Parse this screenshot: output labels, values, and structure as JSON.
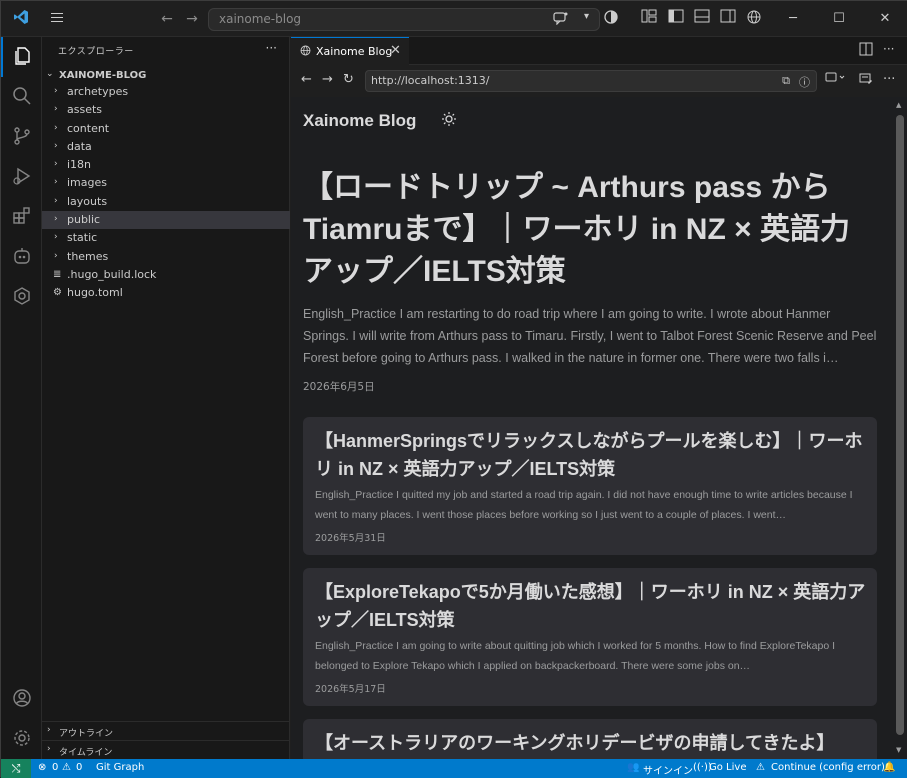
{
  "titlebar": {
    "search_text": "xainome-blog"
  },
  "sidebar": {
    "title": "エクスプローラー",
    "root": "XAINOME-BLOG",
    "items": [
      {
        "label": "archetypes",
        "type": "folder"
      },
      {
        "label": "assets",
        "type": "folder"
      },
      {
        "label": "content",
        "type": "folder"
      },
      {
        "label": "data",
        "type": "folder"
      },
      {
        "label": "i18n",
        "type": "folder"
      },
      {
        "label": "images",
        "type": "folder"
      },
      {
        "label": "layouts",
        "type": "folder"
      },
      {
        "label": "public",
        "type": "folder",
        "selected": true
      },
      {
        "label": "static",
        "type": "folder"
      },
      {
        "label": "themes",
        "type": "folder"
      },
      {
        "label": ".hugo_build.lock",
        "type": "file"
      },
      {
        "label": "hugo.toml",
        "type": "settings-file"
      }
    ],
    "outline_label": "アウトライン",
    "timeline_label": "タイムライン"
  },
  "editor": {
    "tab_title": "Xainome Blog",
    "url": "http://localhost:1313/"
  },
  "page": {
    "site_title": "Xainome Blog",
    "hero": {
      "title": "【ロードトリップ ~ Arthurs pass から Tiamruまで】｜ワーホリ in NZ × 英語力アップ／IELTS対策",
      "summary": "English_Practice I am restarting to do road trip where I am going to write. I wrote about Hanmer Springs. I will write from Arthurs pass to Timaru. Firstly, I went to Talbot Forest Scenic Reserve and Peel Forest before going to Arthurs pass. I walked in the nature in former one. There were two falls i…",
      "date": "2026年6月5日"
    },
    "posts": [
      {
        "title": "【HanmerSpringsでリラックスしながらプールを楽しむ】｜ワーホリ in NZ × 英語力アップ／IELTS対策",
        "summary": "English_Practice I quitted my job and started a road trip again. I did not have enough time to write articles because I went to many places. I went those places before working so I just went to a couple of places. I went…",
        "date": "2026年5月31日"
      },
      {
        "title": "【ExploreTekapoで5か月働いた感想】｜ワーホリ in NZ × 英語力アップ／IELTS対策",
        "summary": "English_Practice I am going to write about quitting job which I worked for 5 months. How to find ExploreTekapo I belonged to Explore Tekapo which I applied on backpackerboard. There were some jobs on…",
        "date": "2026年5月17日"
      },
      {
        "title": "【オーストラリアのワーキングホリデービザの申請してきたよ】",
        "summary": "",
        "date": ""
      }
    ]
  },
  "statusbar": {
    "errors": "0",
    "warnings": "0",
    "git_graph": "Git Graph",
    "signin": "サインイン",
    "go_live": "Go Live",
    "continue": "Continue (config error)"
  },
  "colors": {
    "accent": "#0078d4",
    "statusbar": "#007acc",
    "card_bg": "#2e2e33",
    "page_bg": "#1d1e20"
  }
}
